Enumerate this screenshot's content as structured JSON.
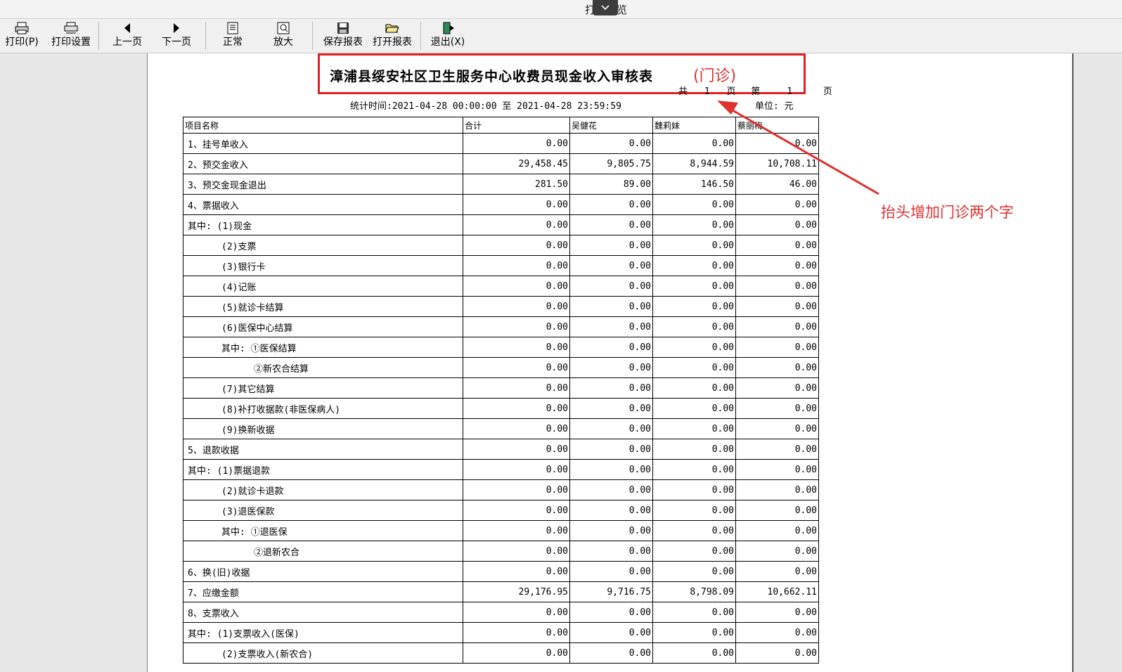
{
  "window": {
    "title": "打印预览"
  },
  "toolbar": {
    "print": "打印(P)",
    "print_settings": "打印设置",
    "prev_page": "上一页",
    "next_page": "下一页",
    "normal": "正常",
    "zoom_in": "放大",
    "save_report": "保存报表",
    "open_report": "打开报表",
    "exit": "退出(X)"
  },
  "report": {
    "title": "漳浦县绥安社区卫生服务中心收费员现金收入审核表",
    "title_addition": "(门诊)",
    "page_info": {
      "total_label": "共",
      "total": "1",
      "page_label": "页",
      "current_label": "第",
      "current": "1",
      "current_suffix": "页"
    },
    "stat_time": "统计时间:2021-04-28 00:00:00 至 2021-04-28 23:59:59",
    "unit": "单位: 元",
    "columns": [
      "项目名称",
      "合计",
      "吴健花",
      "魏莉妹",
      "蔡丽梅"
    ],
    "rows": [
      {
        "name": "1、挂号单收入",
        "indent": 0,
        "values": [
          "0.00",
          "0.00",
          "0.00",
          "0.00"
        ]
      },
      {
        "name": "2、预交金收入",
        "indent": 0,
        "values": [
          "29,458.45",
          "9,805.75",
          "8,944.59",
          "10,708.11"
        ]
      },
      {
        "name": "3、预交金现金退出",
        "indent": 0,
        "values": [
          "281.50",
          "89.00",
          "146.50",
          "46.00"
        ]
      },
      {
        "name": "4、票据收入",
        "indent": 0,
        "values": [
          "0.00",
          "0.00",
          "0.00",
          "0.00"
        ]
      },
      {
        "name": "其中: (1)现金",
        "indent": 0,
        "values": [
          "0.00",
          "0.00",
          "0.00",
          "0.00"
        ]
      },
      {
        "name": "(2)支票",
        "indent": 1,
        "values": [
          "0.00",
          "0.00",
          "0.00",
          "0.00"
        ]
      },
      {
        "name": "(3)银行卡",
        "indent": 1,
        "values": [
          "0.00",
          "0.00",
          "0.00",
          "0.00"
        ]
      },
      {
        "name": "(4)记账",
        "indent": 1,
        "values": [
          "0.00",
          "0.00",
          "0.00",
          "0.00"
        ]
      },
      {
        "name": "(5)就诊卡结算",
        "indent": 1,
        "values": [
          "0.00",
          "0.00",
          "0.00",
          "0.00"
        ]
      },
      {
        "name": "(6)医保中心结算",
        "indent": 1,
        "values": [
          "0.00",
          "0.00",
          "0.00",
          "0.00"
        ]
      },
      {
        "name": "其中: ①医保结算",
        "indent": 1,
        "values": [
          "0.00",
          "0.00",
          "0.00",
          "0.00"
        ]
      },
      {
        "name": "②新农合结算",
        "indent": 2,
        "values": [
          "0.00",
          "0.00",
          "0.00",
          "0.00"
        ]
      },
      {
        "name": "(7)其它结算",
        "indent": 1,
        "values": [
          "0.00",
          "0.00",
          "0.00",
          "0.00"
        ]
      },
      {
        "name": "(8)补打收据款(非医保病人)",
        "indent": 1,
        "values": [
          "0.00",
          "0.00",
          "0.00",
          "0.00"
        ]
      },
      {
        "name": "(9)换新收据",
        "indent": 1,
        "values": [
          "0.00",
          "0.00",
          "0.00",
          "0.00"
        ]
      },
      {
        "name": "5、退款收据",
        "indent": 0,
        "values": [
          "0.00",
          "0.00",
          "0.00",
          "0.00"
        ]
      },
      {
        "name": "其中: (1)票据退款",
        "indent": 0,
        "values": [
          "0.00",
          "0.00",
          "0.00",
          "0.00"
        ]
      },
      {
        "name": "(2)就诊卡退款",
        "indent": 1,
        "values": [
          "0.00",
          "0.00",
          "0.00",
          "0.00"
        ]
      },
      {
        "name": "(3)退医保款",
        "indent": 1,
        "values": [
          "0.00",
          "0.00",
          "0.00",
          "0.00"
        ]
      },
      {
        "name": "其中: ①退医保",
        "indent": 1,
        "values": [
          "0.00",
          "0.00",
          "0.00",
          "0.00"
        ]
      },
      {
        "name": "②退新农合",
        "indent": 2,
        "values": [
          "0.00",
          "0.00",
          "0.00",
          "0.00"
        ]
      },
      {
        "name": "6、换(旧)收据",
        "indent": 0,
        "values": [
          "0.00",
          "0.00",
          "0.00",
          "0.00"
        ]
      },
      {
        "name": "7、应缴金额",
        "indent": 0,
        "values": [
          "29,176.95",
          "9,716.75",
          "8,798.09",
          "10,662.11"
        ]
      },
      {
        "name": "8、支票收入",
        "indent": 0,
        "values": [
          "0.00",
          "0.00",
          "0.00",
          "0.00"
        ]
      },
      {
        "name": "其中: (1)支票收入(医保)",
        "indent": 0,
        "values": [
          "0.00",
          "0.00",
          "0.00",
          "0.00"
        ]
      },
      {
        "name": "(2)支票收入(新农合)",
        "indent": 1,
        "values": [
          "0.00",
          "0.00",
          "0.00",
          "0.00"
        ]
      }
    ]
  },
  "annotation": {
    "text": "抬头增加门诊两个字",
    "color": "#e03030"
  }
}
